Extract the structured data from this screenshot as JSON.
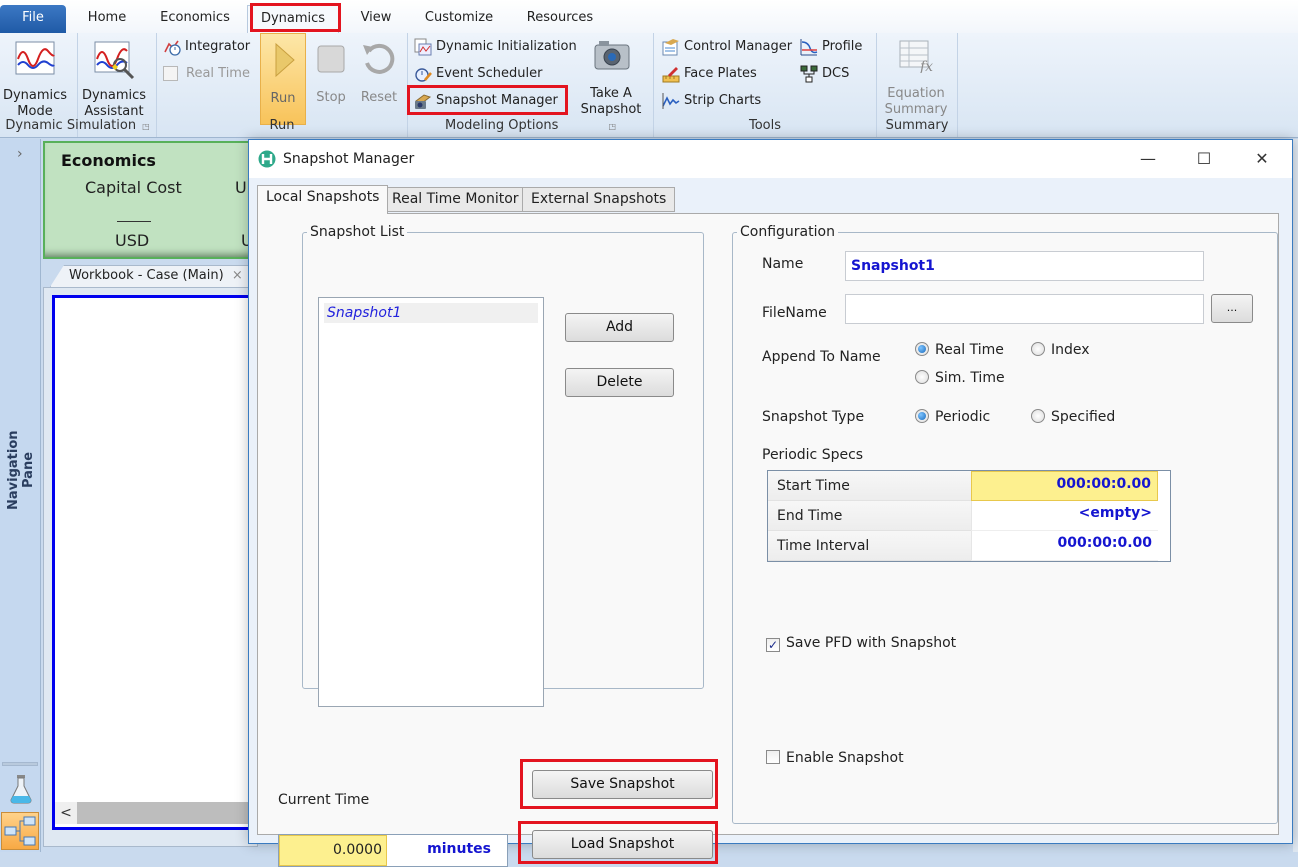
{
  "ribbon": {
    "tabs": [
      "File",
      "Home",
      "Economics",
      "Dynamics",
      "View",
      "Customize",
      "Resources"
    ],
    "active_tab": "Dynamics",
    "groups": {
      "dynamic_simulation": {
        "label": "Dynamic Simulation",
        "dynamics_mode": "Dynamics\nMode",
        "dynamics_mode_l1": "Dynamics",
        "dynamics_mode_l2": "Mode",
        "dynamics_assistant_l1": "Dynamics",
        "dynamics_assistant_l2": "Assistant"
      },
      "run": {
        "label": "Run",
        "integrator": "Integrator",
        "real_time": "Real Time",
        "run": "Run",
        "stop": "Stop",
        "reset": "Reset"
      },
      "modeling_options": {
        "label": "Modeling Options",
        "dynamic_initialization": "Dynamic Initialization",
        "event_scheduler": "Event Scheduler",
        "snapshot_manager": "Snapshot Manager",
        "take_snapshot_l1": "Take A",
        "take_snapshot_l2": "Snapshot"
      },
      "tools": {
        "label": "Tools",
        "control_manager": "Control Manager",
        "face_plates": "Face Plates",
        "strip_charts": "Strip Charts",
        "profile": "Profile",
        "dcs": "DCS"
      },
      "summary": {
        "label": "Summary",
        "equation_summary_l1": "Equation",
        "equation_summary_l2": "Summary"
      }
    }
  },
  "nav": {
    "label": "Navigation Pane",
    "toggle": "›"
  },
  "economics": {
    "title": "Economics",
    "capital_cost": "Capital Cost",
    "capital_cost_unit": "USD",
    "next_partial": "U",
    "next_unit_partial": "U"
  },
  "workbook": {
    "tab_label": "Workbook - Case (Main)",
    "close": "×",
    "scroll_left": "<"
  },
  "dialog": {
    "title": "Snapshot Manager",
    "minimize": "—",
    "maximize": "☐",
    "close": "✕",
    "tabs": [
      "Local Snapshots",
      "Real Time Monitor",
      "External Snapshots"
    ],
    "active_tab": "Local Snapshots",
    "snapshot_list": {
      "legend": "Snapshot List",
      "items": [
        "Snapshot1"
      ],
      "add": "Add",
      "delete": "Delete"
    },
    "current_time": {
      "label": "Current Time",
      "value": "0.0000",
      "unit": "minutes"
    },
    "save_snapshot": "Save Snapshot",
    "load_snapshot": "Load Snapshot",
    "configuration": {
      "legend": "Configuration",
      "name_label": "Name",
      "name_value": "Snapshot1",
      "filename_label": "FileName",
      "filename_value": "",
      "browse": "...",
      "append_label": "Append To Name",
      "append_options": [
        "Real Time",
        "Index",
        "Sim. Time"
      ],
      "append_selected": "Real Time",
      "type_label": "Snapshot Type",
      "type_options": [
        "Periodic",
        "Specified"
      ],
      "type_selected": "Periodic",
      "periodic_specs_label": "Periodic Specs",
      "periodic_specs": [
        {
          "label": "Start Time",
          "value": "000:00:0.00"
        },
        {
          "label": "End Time",
          "value": "<empty>"
        },
        {
          "label": "Time Interval",
          "value": "000:00:0.00"
        }
      ],
      "save_pfd": {
        "label": "Save PFD with Snapshot",
        "checked": true
      },
      "enable_snapshot": {
        "label": "Enable Snapshot",
        "checked": false
      }
    }
  },
  "colors": {
    "highlight_red": "#e3141f",
    "value_blue": "#1515d0",
    "cell_yellow": "#fdf08f",
    "economics_green": "#c1e2c1"
  }
}
